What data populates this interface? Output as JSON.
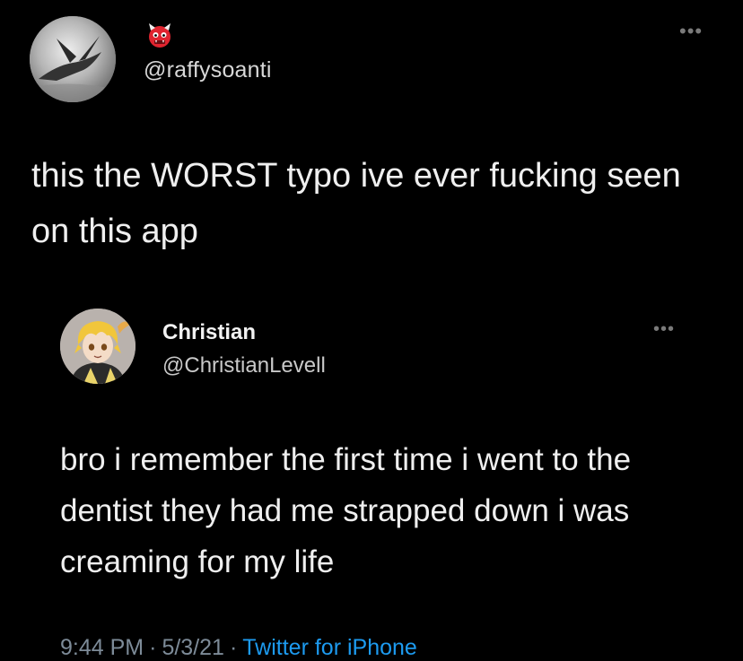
{
  "outer_tweet": {
    "handle": "@raffysoanti",
    "text": "this the WORST typo ive ever fucking seen on this app",
    "more_label": "•••",
    "avatar_icon": "dragon-avatar-icon",
    "badge_icon": "ogre-emoji-icon"
  },
  "quoted_tweet": {
    "name": "Christian",
    "handle": "@ChristianLevell",
    "text": "bro i remember the first time i went to the dentist they had me strapped down i was creaming for my life",
    "more_label": "•••",
    "avatar_icon": "anime-avatar-icon",
    "time": "9:44 PM",
    "separator": "·",
    "date": "5/3/21",
    "source": "Twitter for iPhone"
  },
  "colors": {
    "background": "#000000",
    "text": "#efefef",
    "secondary": "#7d8b98",
    "link": "#1d9bf0",
    "badge_red": "#e0242f"
  }
}
